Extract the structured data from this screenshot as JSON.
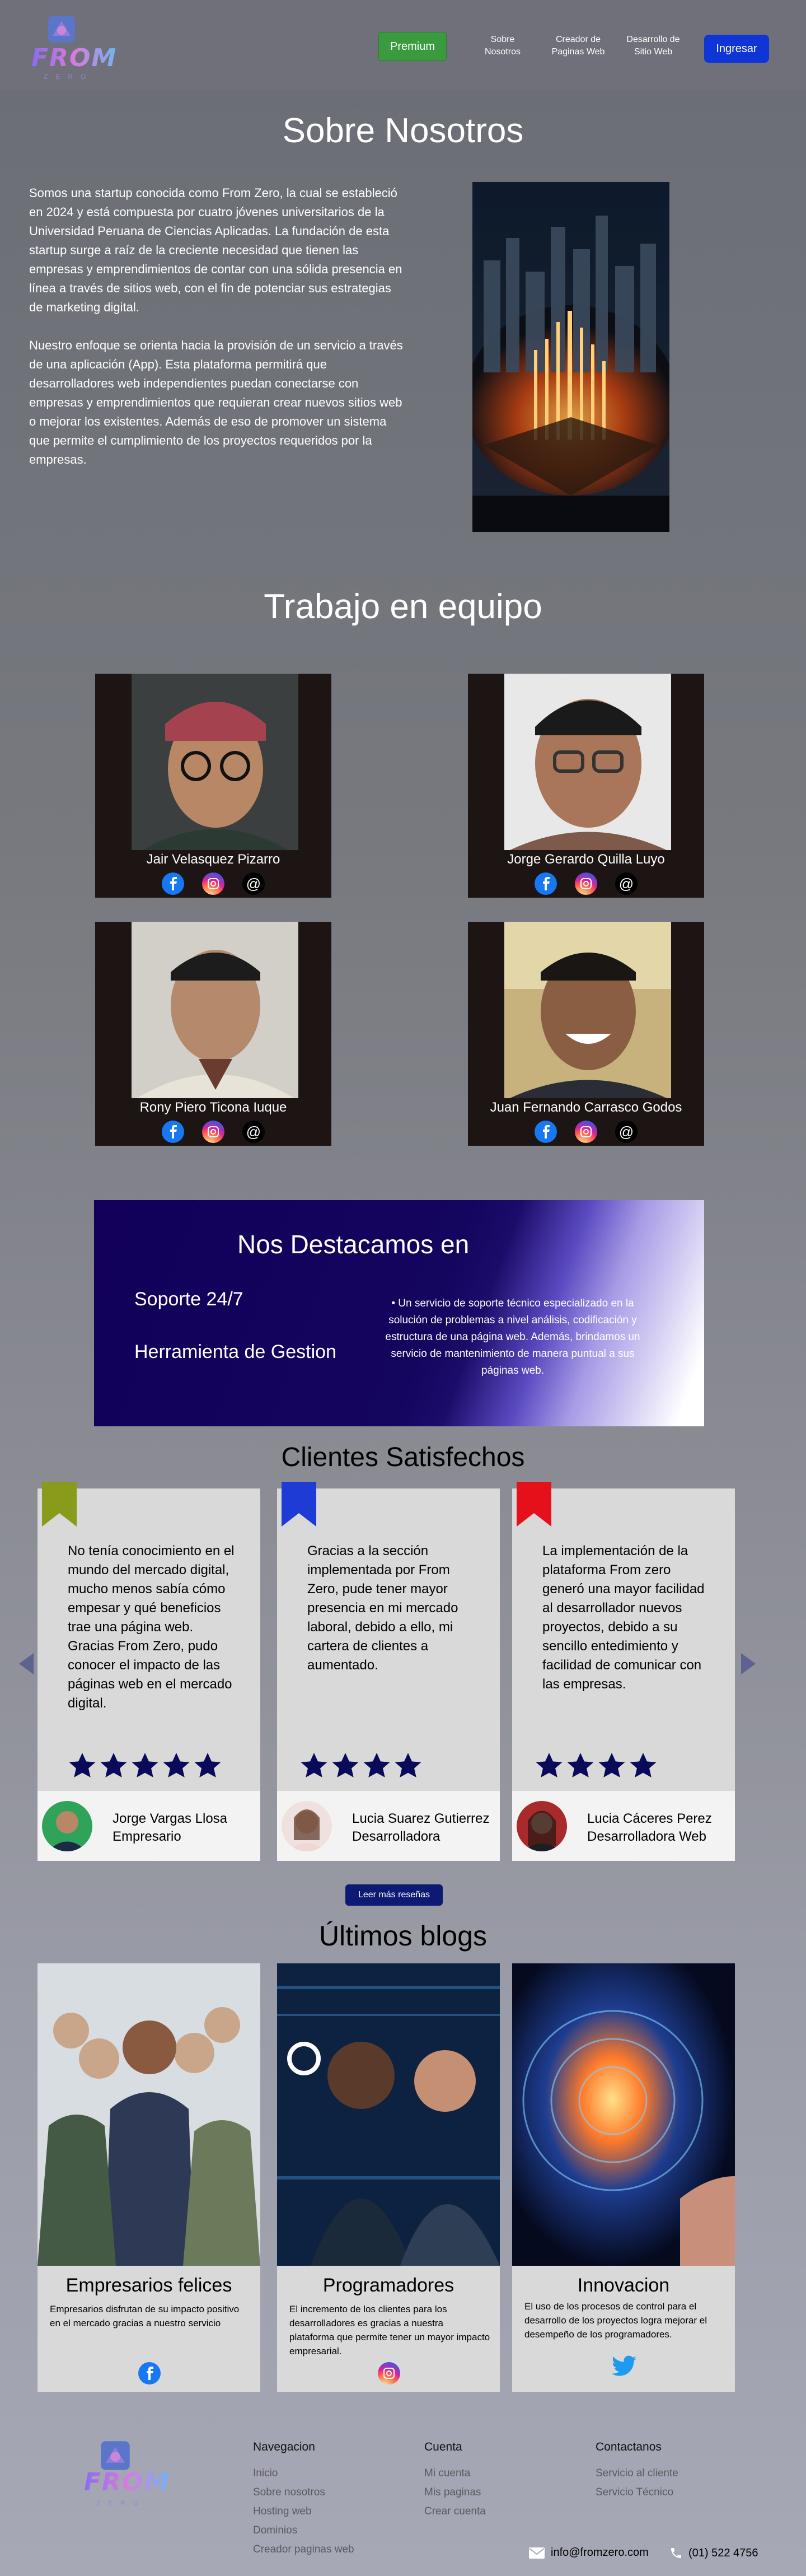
{
  "header": {
    "premium": "Premium",
    "nav": [
      "Sobre Nosotros",
      "Creador de Paginas Web",
      "Desarrollo de Sitio Web"
    ],
    "login": "Ingresar",
    "logo_word": "FROM",
    "logo_sub": "ZERO"
  },
  "about": {
    "title": "Sobre Nosotros",
    "p1": "Somos una startup conocida como From Zero, la cual se estableció en 2024 y está compuesta por cuatro jóvenes universitarios de la Universidad Peruana de Ciencias Aplicadas. La fundación de esta startup surge a raíz de la creciente necesidad que tienen las empresas y emprendimientos de contar con una sólida presencia en línea a través de sitios web, con el fin de potenciar sus estrategias de marketing digital.",
    "p2": "Nuestro enfoque se orienta hacia la provisión de un servicio a través de una aplicación (App). Esta plataforma permitirá que desarrolladores web independientes puedan conectarse con empresas y emprendimientos que requieran crear nuevos sitios web o mejorar los existentes. Además de eso de promover un sistema que permite el cumplimiento de los proyectos requeridos por la empresas."
  },
  "team": {
    "title": "Trabajo en equipo",
    "members": [
      {
        "name": "Jair Velasquez Pizarro"
      },
      {
        "name": "Jorge Gerardo Quilla Luyo"
      },
      {
        "name": "Rony Piero Ticona Iuque"
      },
      {
        "name": "Juan Fernando Carrasco Godos"
      }
    ]
  },
  "highlight": {
    "title": "Nos Destacamos en",
    "item1": "Soporte 24/7",
    "item2": "Herramienta de Gestion",
    "desc": "Un servicio de soporte técnico especializado en la solución de problemas a nivel análisis, codificación y estructura de una página web. Además, brindamos un servicio de mantenimiento de manera puntual a sus páginas web."
  },
  "testimonials": {
    "title": "Clientes Satisfechos",
    "button": "Leer más reseñas",
    "items": [
      {
        "text": "No tenía conocimiento en el mundo del mercado digital, mucho menos sabía cómo empesar y qué beneficios trae una página web. Gracias  From Zero, pudo conocer el impacto de las páginas web en el mercado digital.",
        "name": "Jorge Vargas Llosa",
        "role": "Empresario",
        "rating": 5,
        "ribbon": "#8a9a1a"
      },
      {
        "text": "Gracias a la sección implementada por From Zero, pude tener mayor presencia en mi mercado laboral, debido a ello, mi cartera de clientes a aumentado.",
        "name": "Lucia Suarez Gutierrez",
        "role": "Desarrolladora",
        "rating": 4,
        "ribbon": "#1f3bd6"
      },
      {
        "text": "La implementación de la plataforma From zero generó una mayor facilidad al desarrollador nuevos proyectos, debido a su sencillo entedimiento y facilidad de comunicar con las empresas.",
        "name": "Lucia Cáceres Perez",
        "role": "Desarrolladora Web",
        "rating": 4,
        "ribbon": "#e6101a"
      }
    ]
  },
  "blogs": {
    "title": "Últimos blogs",
    "items": [
      {
        "title": "Empresarios felices",
        "text": "Empresarios disfrutan de su impacto positivo en el mercado gracias a nuestro servicio",
        "icon": "facebook-icon"
      },
      {
        "title": "Programadores",
        "text": "El incremento de los clientes para los desarrolladores es gracias a nuestra plataforma que permite tener un mayor impacto empresarial.",
        "icon": "instagram-icon"
      },
      {
        "title": "Innovacion",
        "text": "El uso de los procesos de control para el desarrollo de los proyectos logra mejorar el desempeño de los programadores.",
        "icon": "twitter-icon"
      }
    ]
  },
  "footer": {
    "logo_word": "FROM",
    "logo_sub": "ZERO",
    "col1": {
      "title": "Navegacion",
      "links": [
        "Inicio",
        "Sobre nosotros",
        "Hosting web",
        "Dominios",
        "Creador paginas web"
      ]
    },
    "col2": {
      "title": "Cuenta",
      "links": [
        "Mi cuenta",
        "Mis paginas",
        "Crear cuenta"
      ]
    },
    "col3": {
      "title": "Contactanos",
      "links": [
        "Servicio al cliente",
        "Servicio Técnico"
      ]
    },
    "email": "info@fromzero.com",
    "phone": "(01) 522 4756"
  },
  "colors": {
    "accent_blue": "#0f35d6",
    "premium_green": "#3a9a3e",
    "navy": "#12005a"
  }
}
